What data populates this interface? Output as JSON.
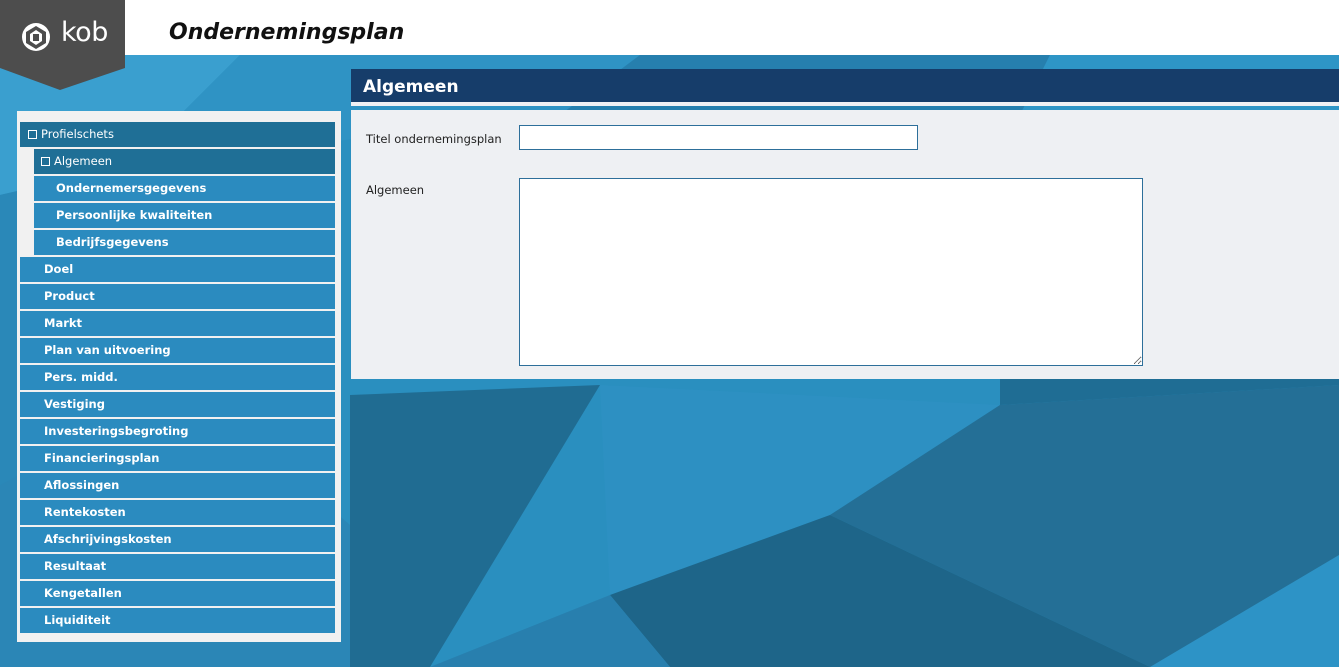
{
  "header": {
    "logo_text": "kob",
    "app_title": "Ondernemingsplan"
  },
  "sidebar": {
    "items": [
      {
        "label": "Profielschets",
        "level": 0,
        "expanded": true
      },
      {
        "label": "Algemeen",
        "level": 1,
        "expanded": true,
        "active": true
      },
      {
        "label": "Ondernemersgegevens",
        "level": 2
      },
      {
        "label": "Persoonlijke kwaliteiten",
        "level": 2
      },
      {
        "label": "Bedrijfsgegevens",
        "level": 2
      },
      {
        "label": "Doel",
        "level": 0
      },
      {
        "label": "Product",
        "level": 0
      },
      {
        "label": "Markt",
        "level": 0
      },
      {
        "label": "Plan van uitvoering",
        "level": 0
      },
      {
        "label": "Pers. midd.",
        "level": 0
      },
      {
        "label": "Vestiging",
        "level": 0
      },
      {
        "label": "Investeringsbegroting",
        "level": 0
      },
      {
        "label": "Financieringsplan",
        "level": 0
      },
      {
        "label": "Aflossingen",
        "level": 0
      },
      {
        "label": "Rentekosten",
        "level": 0
      },
      {
        "label": "Afschrijvingskosten",
        "level": 0
      },
      {
        "label": "Resultaat",
        "level": 0
      },
      {
        "label": "Kengetallen",
        "level": 0
      },
      {
        "label": "Liquiditeit",
        "level": 0
      }
    ]
  },
  "main": {
    "section_title": "Algemeen",
    "fields": {
      "title_label": "Titel ondernemingsplan",
      "title_value": "",
      "general_label": "Algemeen",
      "general_value": ""
    }
  },
  "colors": {
    "nav_item": "#2b8bbf",
    "nav_item_expanded": "#1f6f96",
    "section_header": "#163d6a",
    "form_bg": "#eef0f3",
    "logo_tab": "#4a4a4a"
  }
}
